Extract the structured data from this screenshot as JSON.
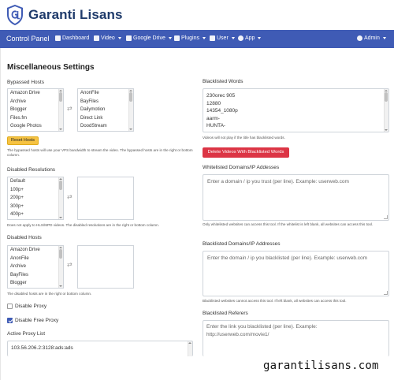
{
  "brand": {
    "name": "Garanti Lisans"
  },
  "navbar": {
    "title": "Control Panel",
    "items": [
      {
        "label": "Dashboard",
        "icon": "dashboard-icon",
        "dropdown": false
      },
      {
        "label": "Video",
        "icon": "film-icon",
        "dropdown": true
      },
      {
        "label": "Google Drive",
        "icon": "google-drive-icon",
        "dropdown": true
      },
      {
        "label": "Plugins",
        "icon": "plugin-icon",
        "dropdown": true
      },
      {
        "label": "User",
        "icon": "user-icon",
        "dropdown": true
      },
      {
        "label": "App",
        "icon": "gear-icon",
        "dropdown": true
      }
    ],
    "admin": "Admin",
    "color": "#3f5bb5"
  },
  "page": {
    "title": "Miscellaneous Settings"
  },
  "bypassed_hosts": {
    "label": "Bypassed Hosts",
    "available": [
      "Amazon Drive",
      "Archive",
      "Blogger",
      "Files.fm",
      "Google Photos"
    ],
    "selected": [
      "AnonFile",
      "BayFiles",
      "Dailymotion",
      "Direct Link",
      "DoodStream"
    ],
    "reset_button": "Reset Hosts",
    "help": "The bypassed hosts will use your VPS bandwidth to stream the video. The bypassed hosts are in the right or bottom column."
  },
  "disabled_resolutions": {
    "label": "Disabled Resolutions",
    "available": [
      "Default",
      "100p+",
      "200p+",
      "300p+",
      "400p+"
    ],
    "selected": [],
    "help": "Does not apply to HLS/MPD videos. The disabled resolutions are in the right or bottom column."
  },
  "disabled_hosts": {
    "label": "Disabled Hosts",
    "available": [
      "Amazon Drive",
      "AnonFile",
      "Archive",
      "BayFiles",
      "Blogger"
    ],
    "selected": [],
    "help": "The disabled hosts are in the right or bottom column."
  },
  "options": {
    "disable_proxy": {
      "label": "Disable Proxy",
      "checked": false
    },
    "disable_free_proxy": {
      "label": "Disable Free Proxy",
      "checked": true
    }
  },
  "active_proxy": {
    "label": "Active Proxy List",
    "lines": [
      "103.56.206.2:3128:ads:ads"
    ]
  },
  "blacklisted_words": {
    "label": "Blacklisted Words",
    "lines": [
      "230orec 905",
      "12880",
      "14354_1080p",
      "aarm-",
      "HUNTA-"
    ],
    "help": "Videos will not play if the title has blacklisted words.",
    "delete_button": "Delete Videos With Blacklisted Words"
  },
  "whitelisted_domains": {
    "label": "Whitelisted Domains/IP Addesses",
    "placeholder": "Enter a domain / ip you trust (per line). Example: userweb.com",
    "help": "Only whitelisted websites can access this tool. If the whitelist is left blank, all websites can access this tool."
  },
  "blacklisted_domains": {
    "label": "Blacklisted Domains/IP Addresses",
    "placeholder": "Enter the domain / ip you blacklisted (per line). Example: userweb.com",
    "help": "Blacklisted websites cannot access this tool. If left blank, all websites can access this tool."
  },
  "blacklisted_referers": {
    "label": "Blacklisted Referers",
    "placeholder_lines": [
      "Enter the link you blacklisted (per line). Example:",
      "http://userweb.com/movie1/"
    ]
  },
  "watermark": "garantilisans.com"
}
